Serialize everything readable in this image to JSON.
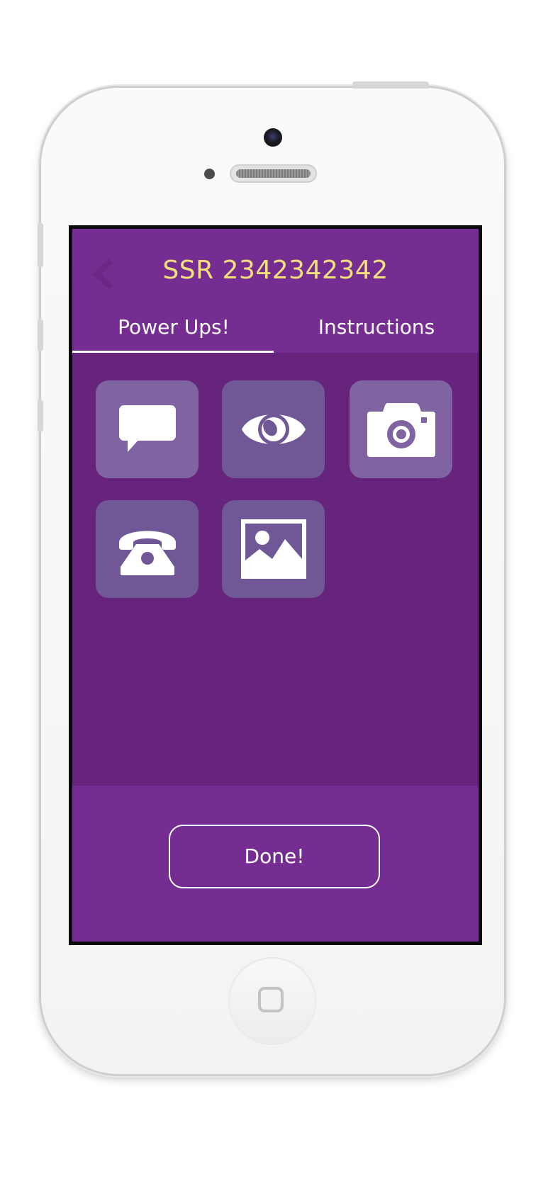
{
  "header": {
    "title": "SSR 2342342342",
    "back_icon": "chevron-left-icon"
  },
  "tabs": [
    {
      "label": "Power Ups!",
      "selected": true
    },
    {
      "label": "Instructions",
      "selected": false
    }
  ],
  "power_ups": [
    {
      "icon": "chat-bubble-icon"
    },
    {
      "icon": "eye-icon"
    },
    {
      "icon": "camera-icon"
    },
    {
      "icon": "telephone-icon"
    },
    {
      "icon": "image-icon"
    }
  ],
  "footer": {
    "done_label": "Done!"
  },
  "colors": {
    "header_bg": "#762d91",
    "content_bg": "#67247c",
    "title_text": "#f2e07c",
    "tile_light": "#7f64a1",
    "tile_dark": "#705896",
    "text": "#ffffff"
  }
}
